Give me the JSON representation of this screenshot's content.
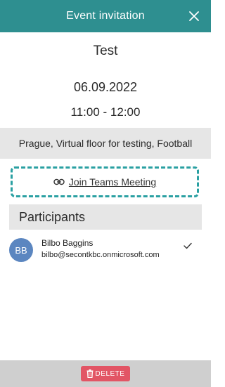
{
  "header": {
    "title": "Event invitation",
    "close_icon": "close-icon"
  },
  "event": {
    "title": "Test",
    "date": "06.09.2022",
    "time": "11:00 - 12:00",
    "location": "Prague, Virtual floor for testing, Football"
  },
  "teams": {
    "link_icon": "link-icon",
    "label": "Join Teams Meeting"
  },
  "participants": {
    "heading": "Participants",
    "items": [
      {
        "initials": "BB",
        "name": "Bilbo Baggins",
        "email": "bilbo@secontkbc.onmicrosoft.com",
        "status_icon": "check-icon"
      }
    ]
  },
  "footer": {
    "delete_label": "DELETE",
    "delete_icon": "trash-icon"
  },
  "colors": {
    "header_bg": "#2e8f90",
    "dashed_border": "#2aa0a2",
    "avatar_bg": "#5b86c0",
    "delete_bg": "#e25565",
    "section_bg": "#e6e6e6",
    "footer_bg": "#cfcfcf"
  }
}
